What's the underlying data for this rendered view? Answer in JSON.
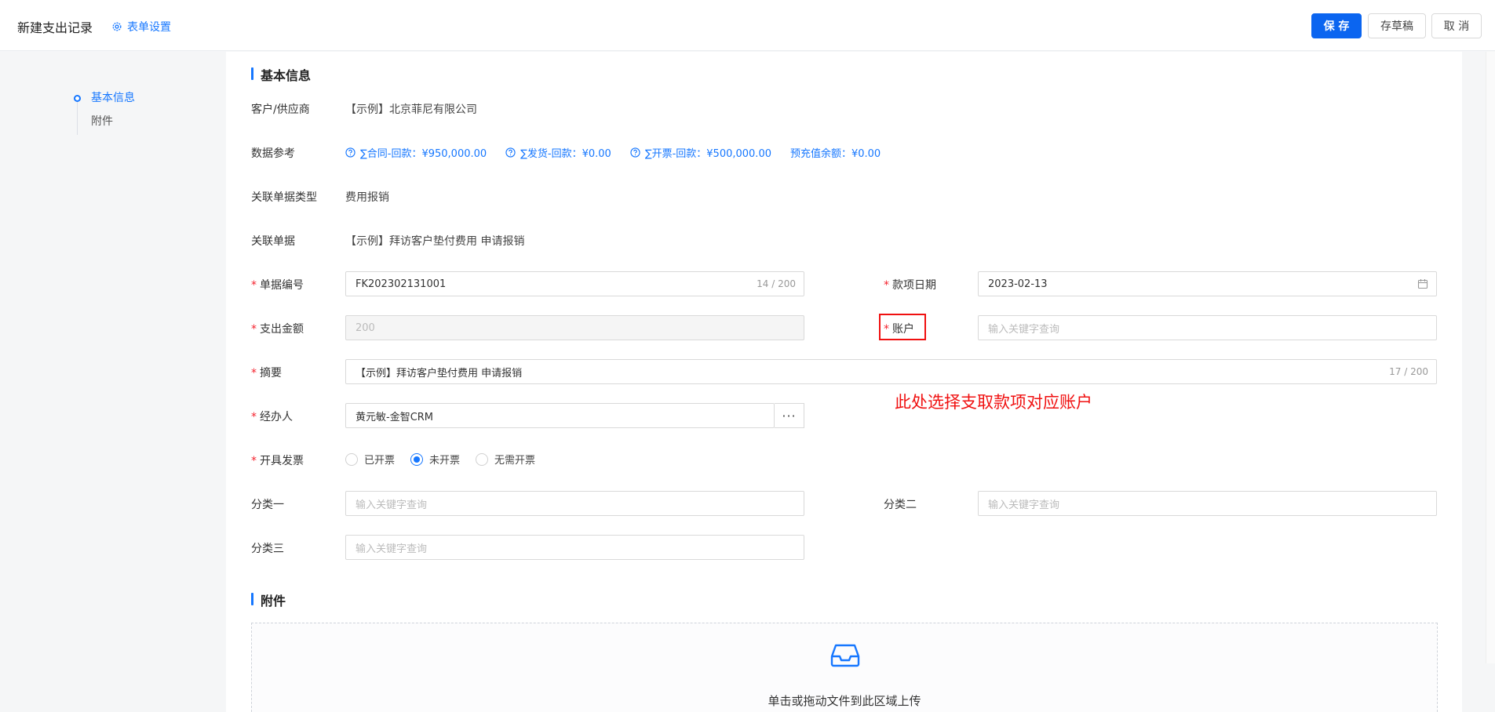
{
  "header": {
    "title": "新建支出记录",
    "form_settings": "表单设置",
    "save": "保 存",
    "draft": "存草稿",
    "cancel": "取 消"
  },
  "nav": [
    {
      "label": "基本信息",
      "active": true
    },
    {
      "label": "附件",
      "active": false
    }
  ],
  "sections": {
    "basic": "基本信息",
    "attachment": "附件"
  },
  "fields": {
    "customer": {
      "label": "客户/供应商",
      "value": "【示例】北京菲尼有限公司"
    },
    "data_ref": {
      "label": "数据参考",
      "links": [
        "∑合同-回款：¥950,000.00",
        "∑发货-回款：¥0.00",
        "∑开票-回款：¥500,000.00"
      ],
      "prepaid": "预充值余额：¥0.00"
    },
    "related_type": {
      "label": "关联单据类型",
      "value": "费用报销"
    },
    "related_doc": {
      "label": "关联单据",
      "value": "【示例】拜访客户垫付费用 申请报销"
    },
    "doc_no": {
      "label": "单据编号",
      "value": "FK202302131001",
      "count": "14 / 200"
    },
    "date": {
      "label": "款项日期",
      "value": "2023-02-13"
    },
    "amount": {
      "label": "支出金额",
      "value": "200"
    },
    "account": {
      "label": "账户",
      "placeholder": "输入关键字查询"
    },
    "summary": {
      "label": "摘要",
      "value": "【示例】拜访客户垫付费用 申请报销",
      "count": "17 / 200"
    },
    "handler": {
      "label": "经办人",
      "value": "黄元敏-金智CRM",
      "more": "···"
    },
    "invoice": {
      "label": "开具发票",
      "options": [
        "已开票",
        "未开票",
        "无需开票"
      ],
      "selected": "未开票"
    },
    "cat1": {
      "label": "分类一",
      "placeholder": "输入关键字查询"
    },
    "cat2": {
      "label": "分类二",
      "placeholder": "输入关键字查询"
    },
    "cat3": {
      "label": "分类三",
      "placeholder": "输入关键字查询"
    }
  },
  "annotation": "此处选择支取款项对应账户",
  "upload": {
    "text": "单击或拖动文件到此区域上传"
  },
  "colors": {
    "primary": "#0b65f0",
    "link": "#1677ff",
    "required": "#f5222d",
    "annotation": "#f01010"
  }
}
